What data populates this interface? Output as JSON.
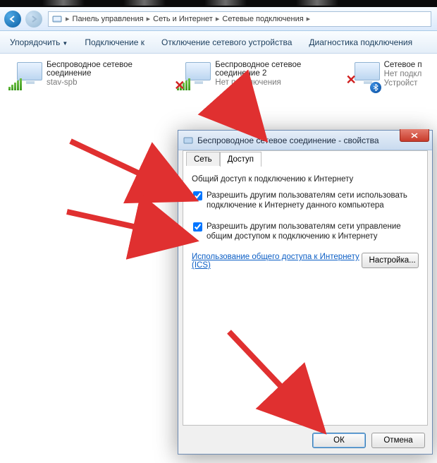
{
  "breadcrumb": {
    "items": [
      "Панель управления",
      "Сеть и Интернет",
      "Сетевые подключения"
    ]
  },
  "toolbar": {
    "items": [
      "Упорядочить",
      "Подключение к",
      "Отключение сетевого устройства",
      "Диагностика подключения"
    ]
  },
  "connections": [
    {
      "title": "Беспроводное сетевое соединение",
      "status": "stav-spb",
      "red_x": false,
      "bt": false
    },
    {
      "title": "Беспроводное сетевое соединение 2",
      "status": "Нет подключения",
      "red_x": true,
      "bt": false
    },
    {
      "title": "Сетевое п",
      "status": "Нет подкл",
      "extra": "Устройст",
      "red_x": true,
      "bt": true
    }
  ],
  "dialog": {
    "title": "Беспроводное сетевое соединение - свойства",
    "tabs": {
      "net": "Сеть",
      "share": "Доступ"
    },
    "group_title": "Общий доступ к подключению к Интернету",
    "chk1": "Разрешить другим пользователям сети использовать подключение к Интернету данного компьютера",
    "chk2": "Разрешить другим пользователям сети управление общим доступом к подключению к Интернету",
    "link": "Использование общего доступа к Интернету (ICS)",
    "settings_btn": "Настройка...",
    "ok": "ОК",
    "cancel": "Отмена"
  }
}
